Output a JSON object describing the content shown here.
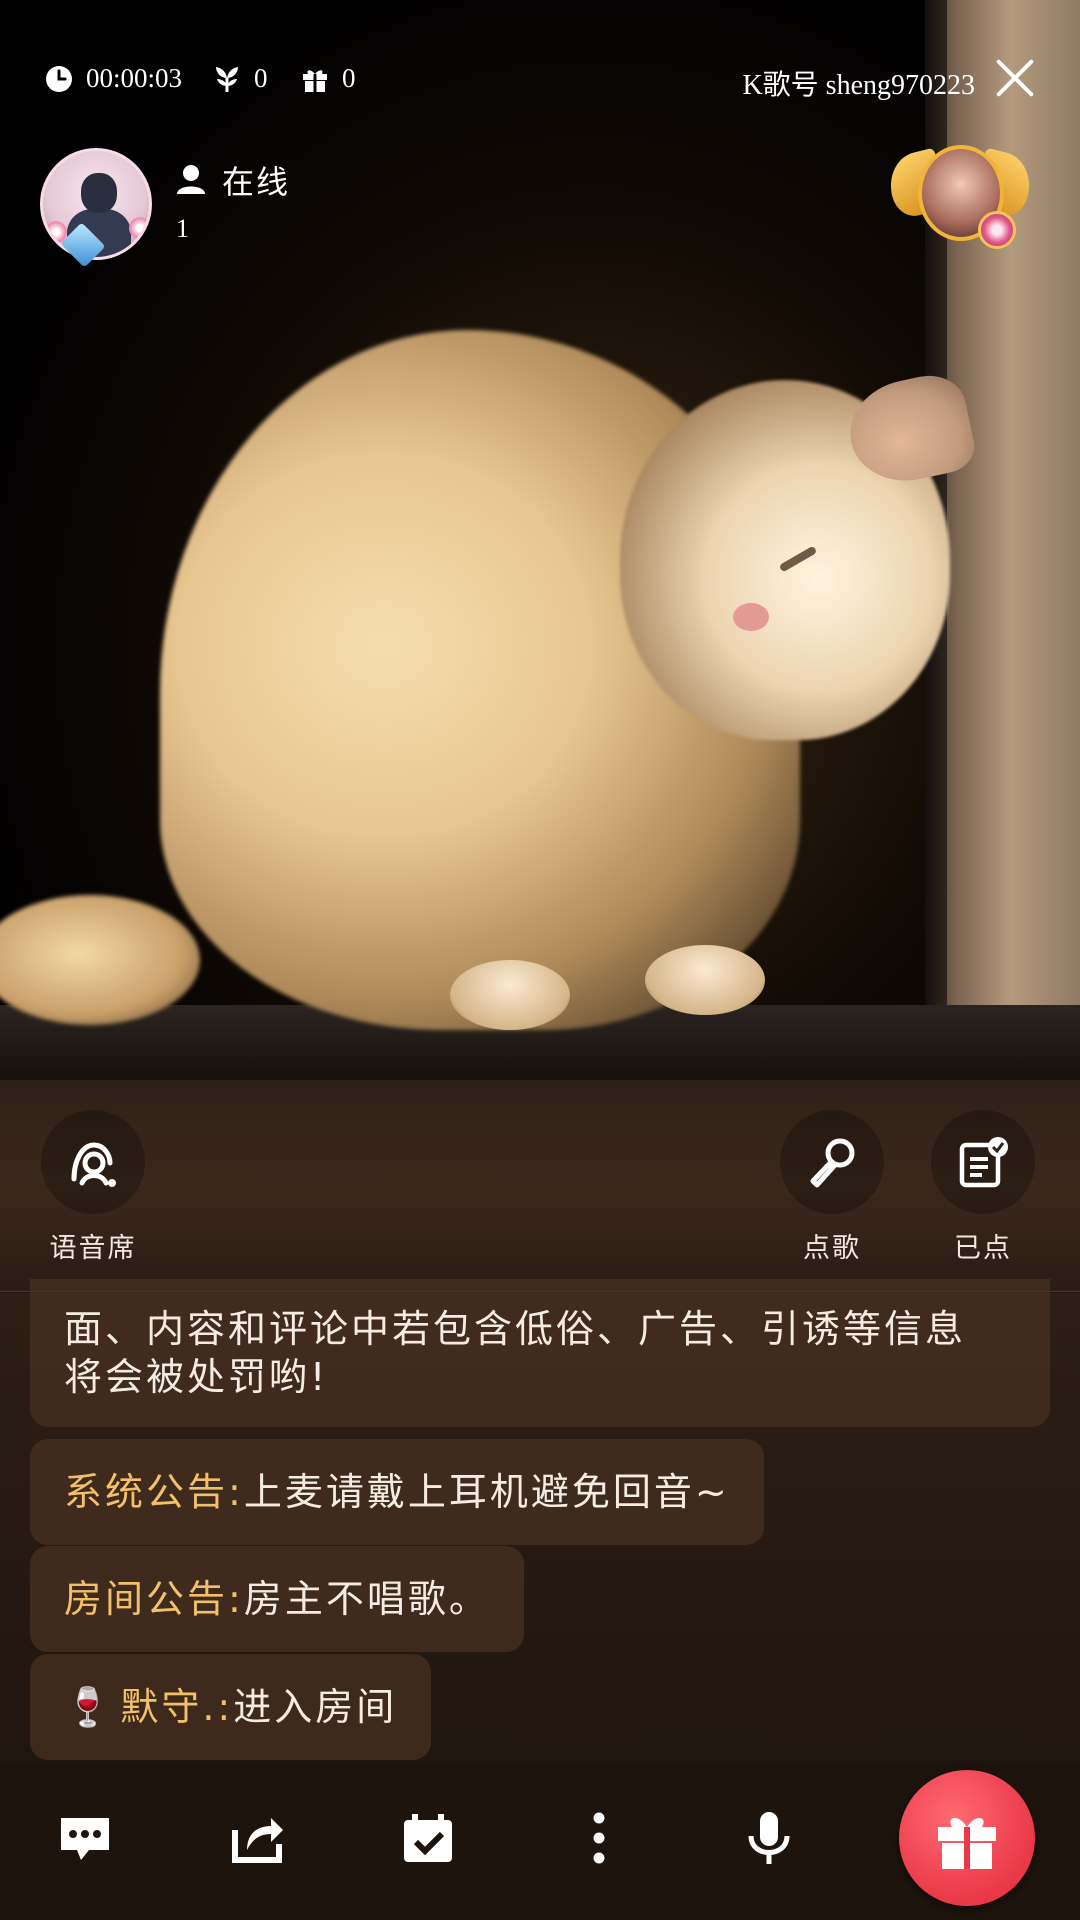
{
  "header": {
    "timer": "00:00:03",
    "flowers": "0",
    "gifts": "0",
    "karaoke_id": "K歌号 sheng970223"
  },
  "host": {
    "online_label": "在线",
    "online_count": "1"
  },
  "panel": {
    "seat_label": "语音席",
    "song_label": "点歌",
    "ordered_label": "已点"
  },
  "chat": {
    "notice_text_line1": "面、内容和评论中若包含低俗、广告、引诱等信息",
    "notice_text_line2": "将会被处罚哟!",
    "system": {
      "name": "系统公告:",
      "text": " 上麦请戴上耳机避免回音~"
    },
    "room": {
      "name": "房间公告:",
      "text": " 房主不唱歌。"
    },
    "enter": {
      "icon": "🍷",
      "name": "默守.:",
      "text": " 进入房间"
    }
  },
  "colors": {
    "accent_gold": "#f2c06a",
    "gift_red": "#ea3848",
    "background": "#1f140e"
  },
  "icons": [
    "clock-icon",
    "flower-icon",
    "gift-box-icon",
    "close-icon",
    "person-icon",
    "voice-seat-icon",
    "microphone-icon",
    "ordered-list-icon",
    "chat-bubble-icon",
    "share-icon",
    "calendar-check-icon",
    "more-vertical-icon",
    "mic-icon",
    "gift-icon"
  ]
}
